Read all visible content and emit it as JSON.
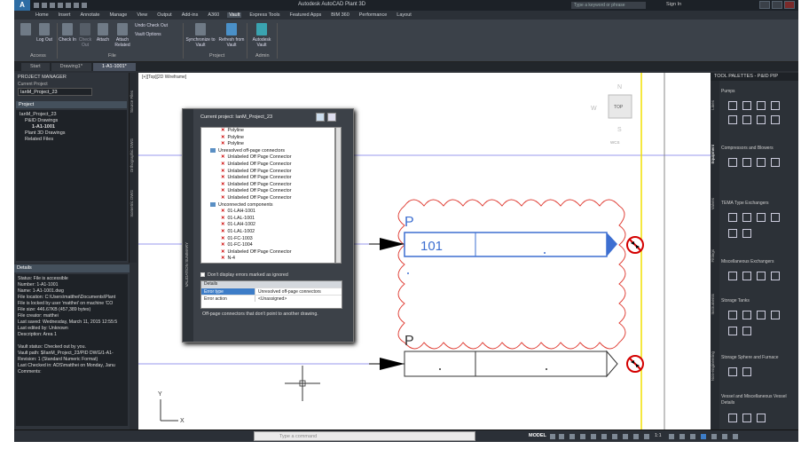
{
  "title_bar": {
    "logo": "A",
    "app_title": "Autodesk AutoCAD Plant 3D",
    "search_placeholder": "Type a keyword or phrase",
    "sign_in": "Sign In"
  },
  "menu": {
    "items": [
      "Home",
      "Insert",
      "Annotate",
      "Manage",
      "View",
      "Output",
      "Add-ins",
      "A360",
      "Vault",
      "Express Tools",
      "Featured Apps",
      "BIM 360",
      "Performance",
      "Layout"
    ],
    "active": "Vault"
  },
  "ribbon": {
    "buttons": {
      "log_out": "Log Out",
      "check_in": "Check In",
      "check_out": "Check Out",
      "attach": "Attach",
      "attach_related": "Attach Related",
      "undo_check_out": "Undo Check Out",
      "vault_options": "Vault Options",
      "synchronize": "Synchronize to Vault",
      "refresh": "Refresh from Vault",
      "autodesk_vault": "Autodesk Vault"
    },
    "panels": {
      "access": "Access",
      "file": "File",
      "project": "Project",
      "admin": "Admin"
    }
  },
  "doc_tabs": [
    "Start",
    "Drawing1*",
    "1-A1-1001*"
  ],
  "doc_tab_active": "1-A1-1001*",
  "project_manager": {
    "title": "PROJECT MANAGER",
    "current_project_label": "Current Project",
    "current_project": "IanM_Project_23",
    "project_header": "Project",
    "tree": [
      "IanM_Project_23",
      "P&ID Drawings",
      "1-A1-1001",
      "Plant 3D Drawings",
      "Related Files"
    ],
    "side_tabs": [
      "Source Files",
      "Orthographic DWG",
      "Isometric DWG"
    ]
  },
  "details": {
    "title": "Details",
    "lines": [
      "Status: File is accessible",
      "Number: 1-A1-1001",
      "Name: 1-A1-1001.dwg",
      "File location: C:\\Users\\matthei\\Documents\\Plant",
      "File is locked by user 'matthei' on machine 'CO",
      "File size: 446.67KB (457,389 bytes)",
      "File creator: matthei",
      "Last saved: Wednesday, March 11, 2015 12:55:5",
      "Last edited by: Unknown",
      "Description: Area 1",
      "",
      "Vault status: Checked out by you.",
      "Vault path: $/IanM_Project_23/PID DWG/1-A1-",
      "Revision: 1 (Standard Numeric Format)",
      "Last Checked in: ADS\\matthei on Monday, Janu",
      "Comments:"
    ]
  },
  "viewport": {
    "label": "[+][Top][2D Wireframe]",
    "viewcube": {
      "top": "TOP",
      "w": "W",
      "n": "N",
      "s": "S",
      "wcs": "WCS"
    },
    "tag_upper": {
      "letter": "P",
      "number": "101"
    },
    "tag_lower": {
      "letter": "P"
    },
    "ucs": {
      "x": "X",
      "y": "Y"
    }
  },
  "validation_dialog": {
    "side_label": "VALIDATION SUMMARY",
    "title": "Current project: IanM_Project_23",
    "tree": [
      {
        "type": "item",
        "text": "Polyline"
      },
      {
        "type": "item",
        "text": "Polyline"
      },
      {
        "type": "item",
        "text": "Polyline"
      },
      {
        "type": "folder",
        "text": "Unresolved off-page connectors"
      },
      {
        "type": "item",
        "text": "Unlabeled Off Page Connector"
      },
      {
        "type": "item",
        "text": "Unlabeled Off Page Connector"
      },
      {
        "type": "item",
        "text": "Unlabeled Off Page Connector"
      },
      {
        "type": "item",
        "text": "Unlabeled Off Page Connector"
      },
      {
        "type": "item",
        "text": "Unlabeled Off Page Connector"
      },
      {
        "type": "item",
        "text": "Unlabeled Off Page Connector"
      },
      {
        "type": "item",
        "text": "Unlabeled Off Page Connector"
      },
      {
        "type": "folder",
        "text": "Unconnected components"
      },
      {
        "type": "item",
        "text": "01-LAH-1001"
      },
      {
        "type": "item",
        "text": "01-LAL-1001"
      },
      {
        "type": "item",
        "text": "01-LAH-1002"
      },
      {
        "type": "item",
        "text": "01-LAL-1002"
      },
      {
        "type": "item",
        "text": "01-FC-1003"
      },
      {
        "type": "item",
        "text": "01-FC-1004"
      },
      {
        "type": "item",
        "text": "Unlabeled Off Page Connector"
      },
      {
        "type": "item",
        "text": "N-4"
      }
    ],
    "ignore_label": "Don't display errors marked as ignored",
    "details_header": "Details",
    "props": [
      {
        "key": "Error type",
        "value": "Unresolved off-page connectors"
      },
      {
        "key": "Error action",
        "value": "<Unassigned>"
      }
    ],
    "description": "Off-page connectors that don't point to another drawing."
  },
  "tool_palettes": {
    "title": "TOOL PALETTES - P&ID PIP",
    "side_tabs": [
      "Lines",
      "Equipment",
      "Valves",
      "Fittings",
      "Instruments",
      "Non-engineering"
    ],
    "sections": [
      "Pumps",
      "Compressors and Blowers",
      "TEMA Type Exchangers",
      "Miscellaneous Exchangers",
      "Storage Tanks",
      "Storage Sphere and Furnace",
      "Vessel and Miscellaneous Vessel Details"
    ]
  },
  "status_bar": {
    "command_placeholder": "Type a command",
    "model": "MODEL",
    "scale": "1:1"
  },
  "colors": {
    "revision_cloud": "#e0433a",
    "connector_blue": "#3d6fd1",
    "guide_yellow": "#f2e000",
    "no_symbol_red": "#d40000"
  }
}
